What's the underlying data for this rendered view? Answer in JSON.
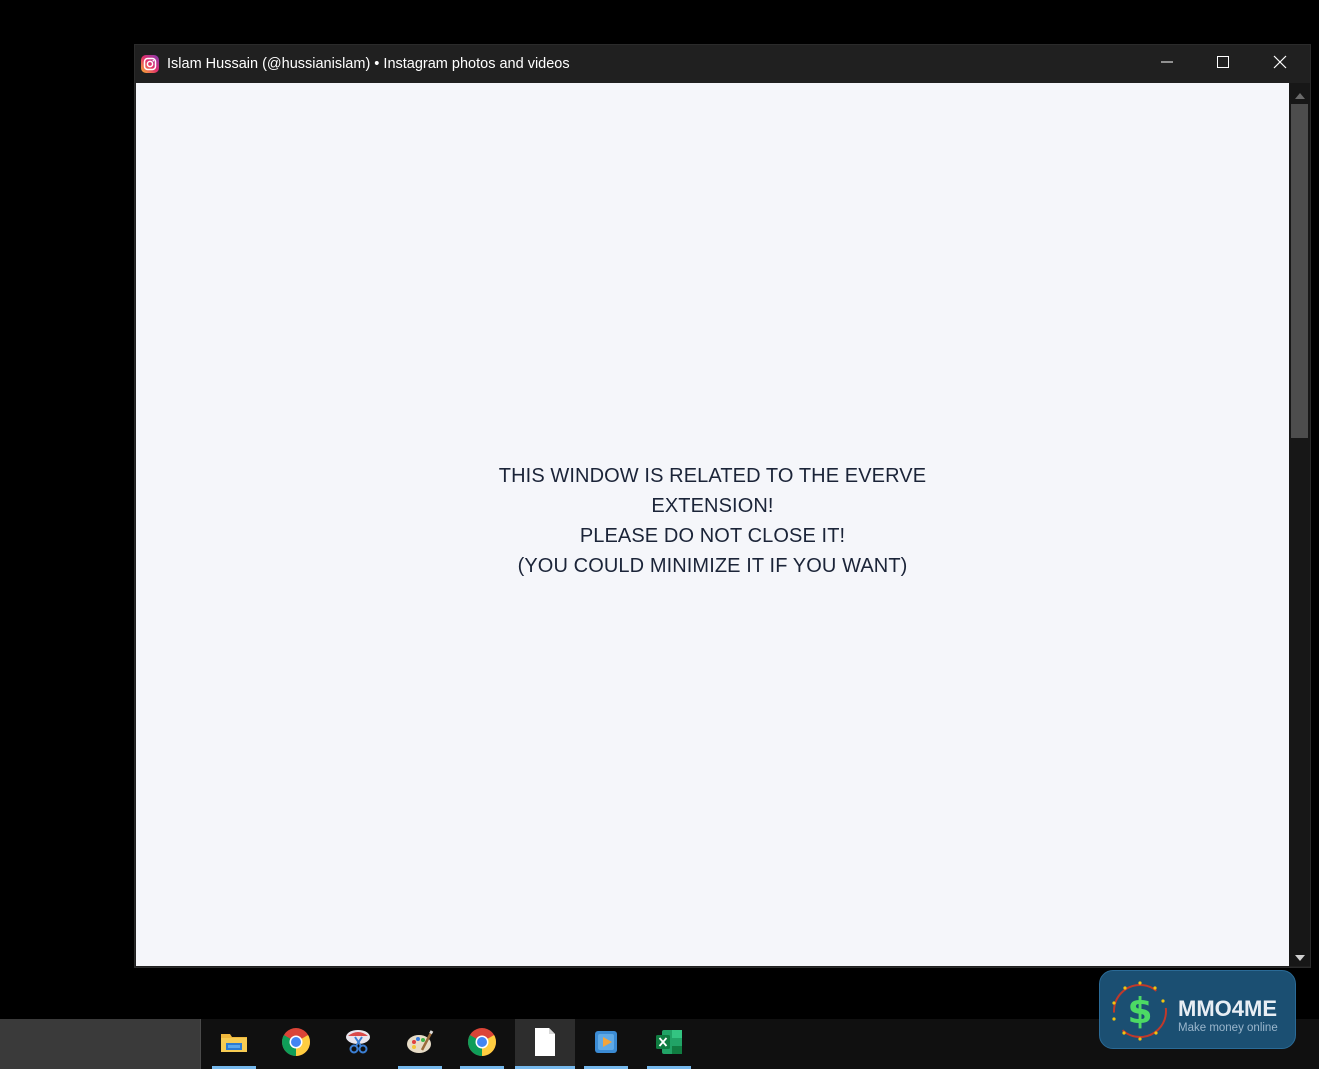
{
  "window": {
    "title": "Islam Hussain (@hussianislam) • Instagram photos and videos",
    "app_icon": "instagram-icon",
    "controls": {
      "minimize": "minimize-icon",
      "maximize": "maximize-icon",
      "close": "close-icon"
    }
  },
  "content": {
    "message_lines": [
      "THIS WINDOW IS RELATED TO THE EVERVE EXTENSION!",
      "PLEASE DO NOT CLOSE IT!",
      "(YOU COULD MINIMIZE IT IF YOU WANT)"
    ],
    "background_color": "#f5f6fa",
    "text_color": "#1b2438"
  },
  "scrollbar": {
    "position_fraction": 0.0
  },
  "taskbar": {
    "items": [
      {
        "icon": "file-explorer-icon",
        "running": true
      },
      {
        "icon": "chrome-icon",
        "running": false
      },
      {
        "icon": "snipping-tool-icon",
        "running": false
      },
      {
        "icon": "paint-icon",
        "running": true
      },
      {
        "icon": "chrome-icon",
        "running": true
      },
      {
        "icon": "document-icon",
        "running": true,
        "active": true
      },
      {
        "icon": "media-player-icon",
        "running": true
      },
      {
        "icon": "excel-icon",
        "running": true
      }
    ],
    "accent_color": "#76b9ed"
  },
  "watermark": {
    "brand": "MMO4ME",
    "tagline": "Make money online",
    "icon": "dollar-sign-icon"
  }
}
